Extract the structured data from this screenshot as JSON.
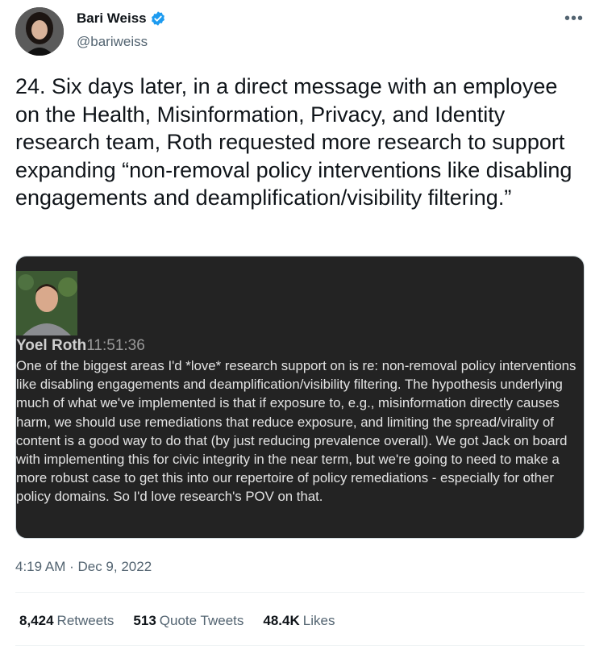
{
  "author": {
    "name": "Bari Weiss",
    "handle": "@bariweiss"
  },
  "more_icon": "more-horizontal-icon",
  "verified_icon": "verified-badge-icon",
  "tweet": {
    "text": "24. Six days later, in a direct message with an employee on the Health, Misinformation, Privacy, and Identity research team, Roth requested more research to support expanding “non-removal policy interventions like disabling engagements and deamplification/visibility filtering.”",
    "timestamp": "4:19 AM · Dec 9, 2022"
  },
  "attached_image": {
    "sender": "Yoel Roth",
    "time": "11:51:36",
    "message": "One of the biggest areas I'd *love* research support on is re: non-removal policy interventions like disabling engagements and deamplification/visibility filtering. The hypothesis underlying much of what we've implemented is that if exposure to, e.g., misinformation directly causes harm, we should use remediations that reduce exposure, and limiting the spread/virality of content is a good way to do that (by just reducing prevalence overall). We got Jack on board with implementing this for civic integrity in the near term, but we're going to need to make a more robust case to get this into our repertoire of policy remediations - especially for other policy domains. So I'd love research's POV on that."
  },
  "stats": {
    "retweets_count": "8,424",
    "retweets_label": "Retweets",
    "quotes_count": "513",
    "quotes_label": "Quote Tweets",
    "likes_count": "48.4K",
    "likes_label": "Likes"
  },
  "colors": {
    "text": "#0f1419",
    "secondary": "#536471",
    "verified": "#1d9bf0",
    "media_bg": "#232323"
  }
}
